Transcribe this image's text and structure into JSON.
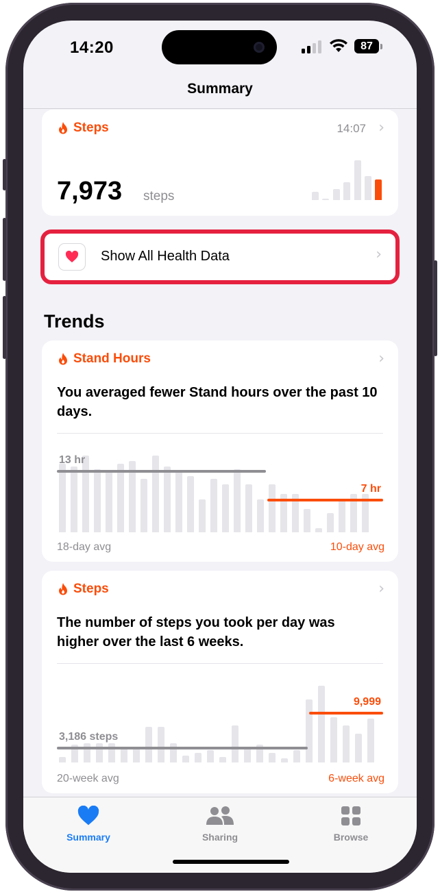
{
  "status_bar": {
    "time": "14:20",
    "battery": "87"
  },
  "nav": {
    "title": "Summary"
  },
  "steps_card": {
    "title": "Steps",
    "time": "14:07",
    "value": "7,973",
    "unit": "steps"
  },
  "show_all": {
    "label": "Show All Health Data"
  },
  "trends": {
    "title": "Trends",
    "stand": {
      "title": "Stand Hours",
      "description": "You averaged fewer Stand hours over the past 10 days.",
      "old_avg_value": "13 hr",
      "new_avg_value": "7 hr",
      "left_label": "18-day avg",
      "right_label": "10-day avg"
    },
    "steps": {
      "title": "Steps",
      "description": "The number of steps you took per day was higher over the last 6 weeks.",
      "old_avg_value": "3,186 steps",
      "new_avg_value": "9,999",
      "left_label": "20-week avg",
      "right_label": "6-week avg"
    }
  },
  "tabbar": {
    "tabs": [
      {
        "label": "Summary",
        "active": true
      },
      {
        "label": "Sharing",
        "active": false
      },
      {
        "label": "Browse",
        "active": false
      }
    ]
  },
  "colors": {
    "accent_orange": "#fa4d0a",
    "tab_active": "#1a7cf5",
    "highlight_red": "#e5213f"
  }
}
